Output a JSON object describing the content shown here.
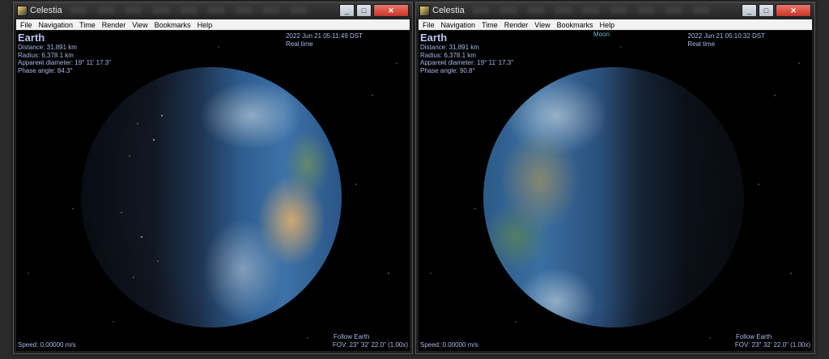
{
  "windows": [
    {
      "title": "Celestia",
      "menu": [
        "File",
        "Navigation",
        "Time",
        "Render",
        "View",
        "Bookmarks",
        "Help"
      ],
      "object_name": "Earth",
      "distance": "Distance: 31,891 km",
      "radius": "Radius: 6,378.1 km",
      "apparent_diameter": "Apparent diameter: 19° 11' 17.3\"",
      "phase_angle": "Phase angle: 84.3°",
      "datetime": "2022 Jun 21 05:11:49 DST",
      "time_mode": "Real time",
      "speed": "Speed: 0.00000 m/s",
      "follow": "Follow Earth",
      "fov": "FOV: 23° 32' 22.0\" (1.00x)"
    },
    {
      "title": "Celestia",
      "menu": [
        "File",
        "Navigation",
        "Time",
        "Render",
        "View",
        "Bookmarks",
        "Help"
      ],
      "object_name": "Earth",
      "distance": "Distance: 31,891 km",
      "radius": "Radius: 6,378.1 km",
      "apparent_diameter": "Apparent diameter: 19° 11' 17.3\"",
      "phase_angle": "Phase angle: 90.8°",
      "datetime": "2022 Jun 21 05:10:32 DST",
      "time_mode": "Real time",
      "moon_label": "Moon",
      "speed": "Speed: 0.00000 m/s",
      "follow": "Follow Earth",
      "fov": "FOV: 23° 32' 22.0\" (1.00x)"
    }
  ]
}
